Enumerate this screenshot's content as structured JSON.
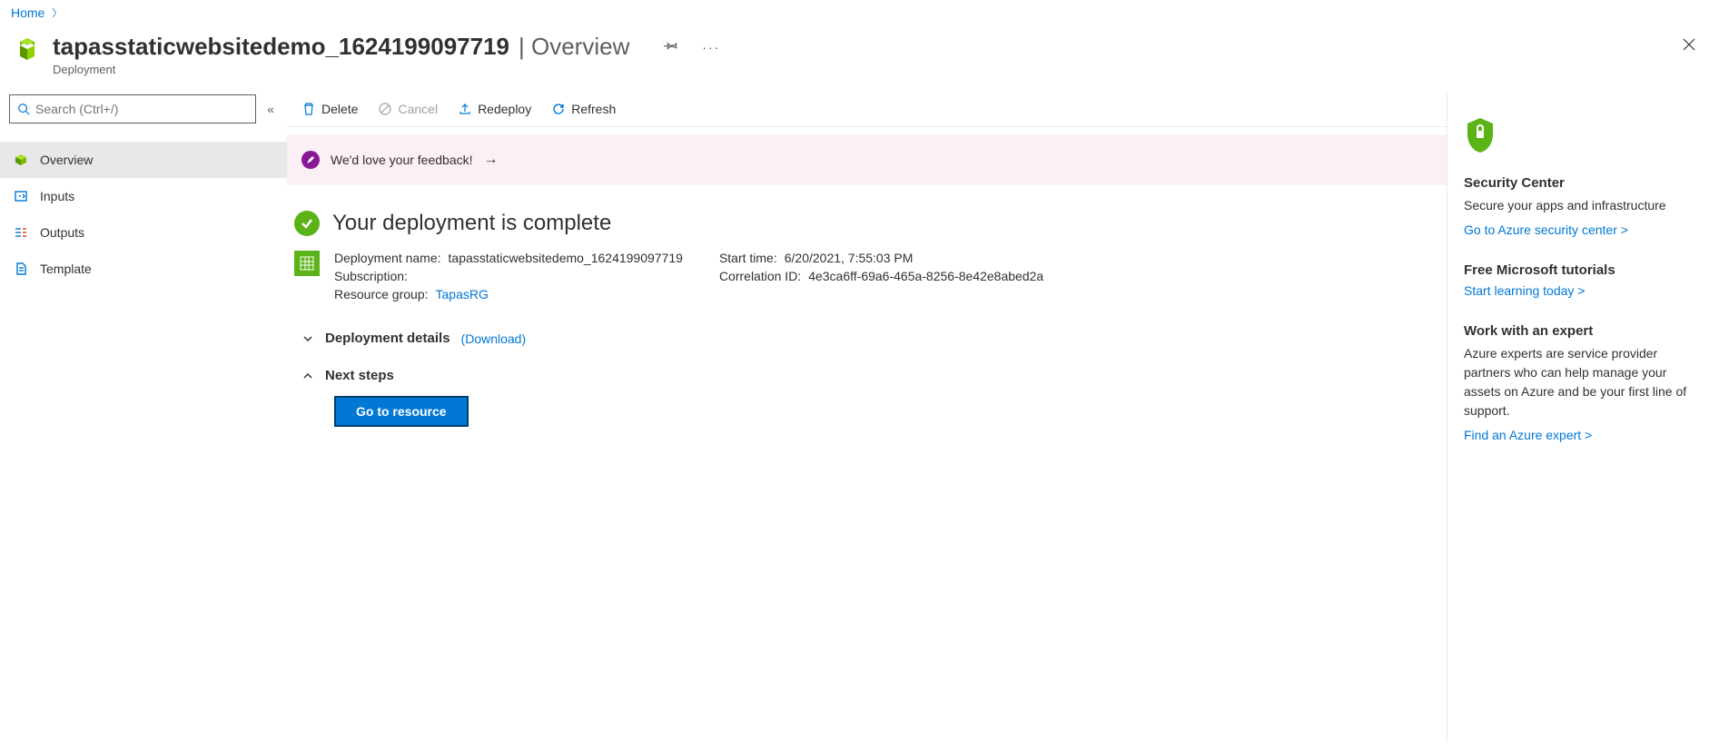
{
  "breadcrumb": {
    "home": "Home"
  },
  "header": {
    "title": "tapasstaticwebsitedemo_1624199097719",
    "section": "Overview",
    "subtitle": "Deployment"
  },
  "search": {
    "placeholder": "Search (Ctrl+/)"
  },
  "sidebar": {
    "items": [
      {
        "label": "Overview"
      },
      {
        "label": "Inputs"
      },
      {
        "label": "Outputs"
      },
      {
        "label": "Template"
      }
    ]
  },
  "toolbar": {
    "delete": "Delete",
    "cancel": "Cancel",
    "redeploy": "Redeploy",
    "refresh": "Refresh"
  },
  "feedback": {
    "text": "We'd love your feedback!"
  },
  "status": {
    "text": "Your deployment is complete"
  },
  "details": {
    "deployment_name_label": "Deployment name:",
    "deployment_name": "tapasstaticwebsitedemo_1624199097719",
    "subscription_label": "Subscription:",
    "subscription": "",
    "resource_group_label": "Resource group:",
    "resource_group": "TapasRG",
    "start_time_label": "Start time:",
    "start_time": "6/20/2021, 7:55:03 PM",
    "correlation_label": "Correlation ID:",
    "correlation": "4e3ca6ff-69a6-465a-8256-8e42e8abed2a"
  },
  "sections": {
    "deployment_details": "Deployment details",
    "download": "(Download)",
    "next_steps": "Next steps",
    "go_to_resource": "Go to resource"
  },
  "right": {
    "security": {
      "title": "Security Center",
      "text": "Secure your apps and infrastructure",
      "link": "Go to Azure security center >"
    },
    "tutorials": {
      "title": "Free Microsoft tutorials",
      "link": "Start learning today >"
    },
    "expert": {
      "title": "Work with an expert",
      "text": "Azure experts are service provider partners who can help manage your assets on Azure and be your first line of support.",
      "link": "Find an Azure expert >"
    }
  }
}
